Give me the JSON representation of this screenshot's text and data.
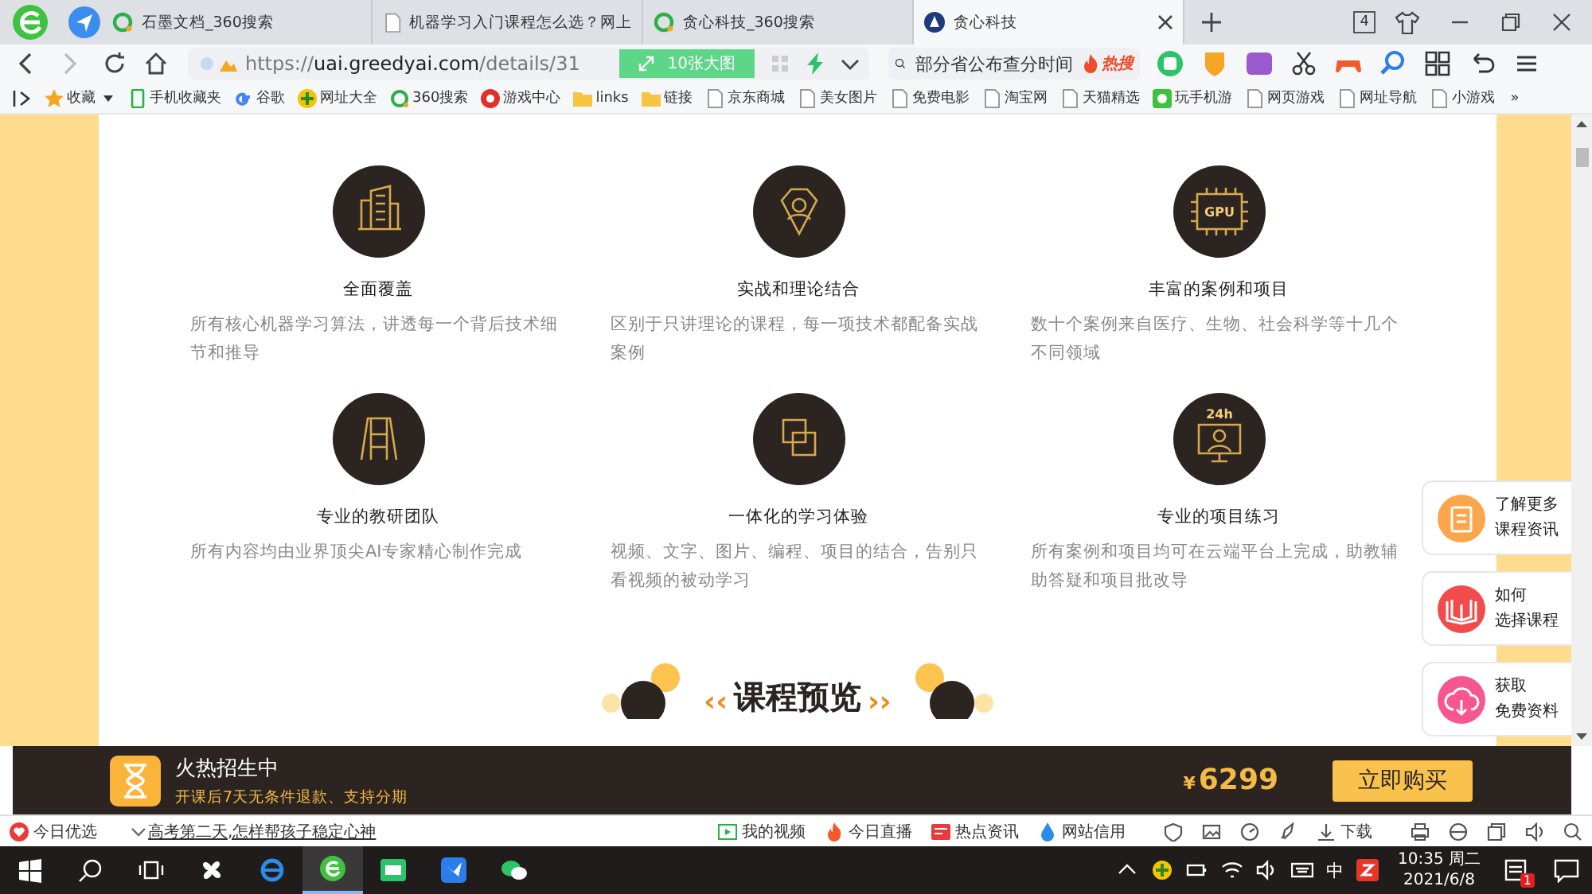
{
  "tabs": [
    {
      "kind": "search",
      "label": "石墨文档_360搜索",
      "selected": false
    },
    {
      "kind": "doc",
      "label": "机器学习入门课程怎么选？网上",
      "selected": false
    },
    {
      "kind": "search",
      "label": "贪心科技_360搜索",
      "selected": false
    },
    {
      "kind": "site",
      "label": "贪心科技",
      "selected": true
    }
  ],
  "tab_count": "4",
  "address": {
    "url_prefix": "https://",
    "url_host": "uai.greedyai.com",
    "url_path": "/details/31",
    "badge": "10张大图"
  },
  "search": {
    "value": "部分省公布查分时间",
    "hot": "热搜"
  },
  "bookmarks": [
    {
      "kind": "star",
      "label": "收藏"
    },
    {
      "kind": "phone",
      "label": "手机收藏夹"
    },
    {
      "kind": "g",
      "label": "谷歌"
    },
    {
      "kind": "plus",
      "label": "网址大全"
    },
    {
      "kind": "ring",
      "label": "360搜索"
    },
    {
      "kind": "game",
      "label": "游戏中心"
    },
    {
      "kind": "folder",
      "label": "links"
    },
    {
      "kind": "folder",
      "label": "链接"
    },
    {
      "kind": "page",
      "label": "京东商城"
    },
    {
      "kind": "page",
      "label": "美女图片"
    },
    {
      "kind": "page",
      "label": "免费电影"
    },
    {
      "kind": "page",
      "label": "淘宝网"
    },
    {
      "kind": "page",
      "label": "天猫精选"
    },
    {
      "kind": "app",
      "label": "玩手机游"
    },
    {
      "kind": "page",
      "label": "网页游戏"
    },
    {
      "kind": "page",
      "label": "网址导航"
    },
    {
      "kind": "page",
      "label": "小游戏"
    }
  ],
  "bookmarks_more": "»",
  "features": [
    {
      "kind": "building",
      "title": "全面覆盖",
      "text": "所有核心机器学习算法，讲透每一个背后技术细节和推导"
    },
    {
      "kind": "badge",
      "title": "实战和理论结合",
      "text": "区别于只讲理论的课程，每一项技术都配备实战案例"
    },
    {
      "kind": "chip",
      "icon_label": "GPU",
      "title": "丰富的案例和项目",
      "text": "数十个案例来自医疗、生物、社会科学等十几个不同领域"
    },
    {
      "kind": "team",
      "title": "专业的教研团队",
      "text": "所有内容均由业界顶尖AI专家精心制作完成"
    },
    {
      "kind": "puzzle",
      "title": "一体化的学习体验",
      "text": "视频、文字、图片、编程、项目的结合，告别只看视频的被动学习"
    },
    {
      "kind": "screen",
      "icon_label": "24h",
      "title": "专业的项目练习",
      "text": "所有案例和项目均可在云端平台上完成，助教辅助答疑和项目批改导"
    }
  ],
  "section_heading": {
    "left": "‹‹",
    "title": "课程预览",
    "right": "››"
  },
  "side_cards": [
    {
      "kind": "info",
      "color": "#fba64a",
      "lines": [
        "了解更多",
        "课程资讯"
      ]
    },
    {
      "kind": "book",
      "color": "#f24b4b",
      "lines": [
        "如何",
        "选择课程"
      ]
    },
    {
      "kind": "cloud",
      "color": "#f7568f",
      "lines": [
        "获取",
        "免费资料"
      ]
    }
  ],
  "promo": {
    "title": "火热招生中",
    "subtitle": "开课后7天无条件退款、支持分期",
    "currency": "¥",
    "price": "6299",
    "button": "立即购买"
  },
  "status_bar": {
    "left": [
      {
        "kind": "heart",
        "label": "今日优选"
      },
      {
        "kind": "headline",
        "label": "高考第二天,怎样帮孩子稳定心神"
      }
    ],
    "right": [
      {
        "kind": "video",
        "label": "我的视频"
      },
      {
        "kind": "fire",
        "label": "今日直播"
      },
      {
        "kind": "news",
        "label": "热点资讯"
      },
      {
        "kind": "drop",
        "label": "网站信用"
      }
    ],
    "download": "下载"
  },
  "taskbar": {
    "ime": "中",
    "time": "10:35 周二",
    "date": "2021/6/8",
    "notifications": "1"
  }
}
